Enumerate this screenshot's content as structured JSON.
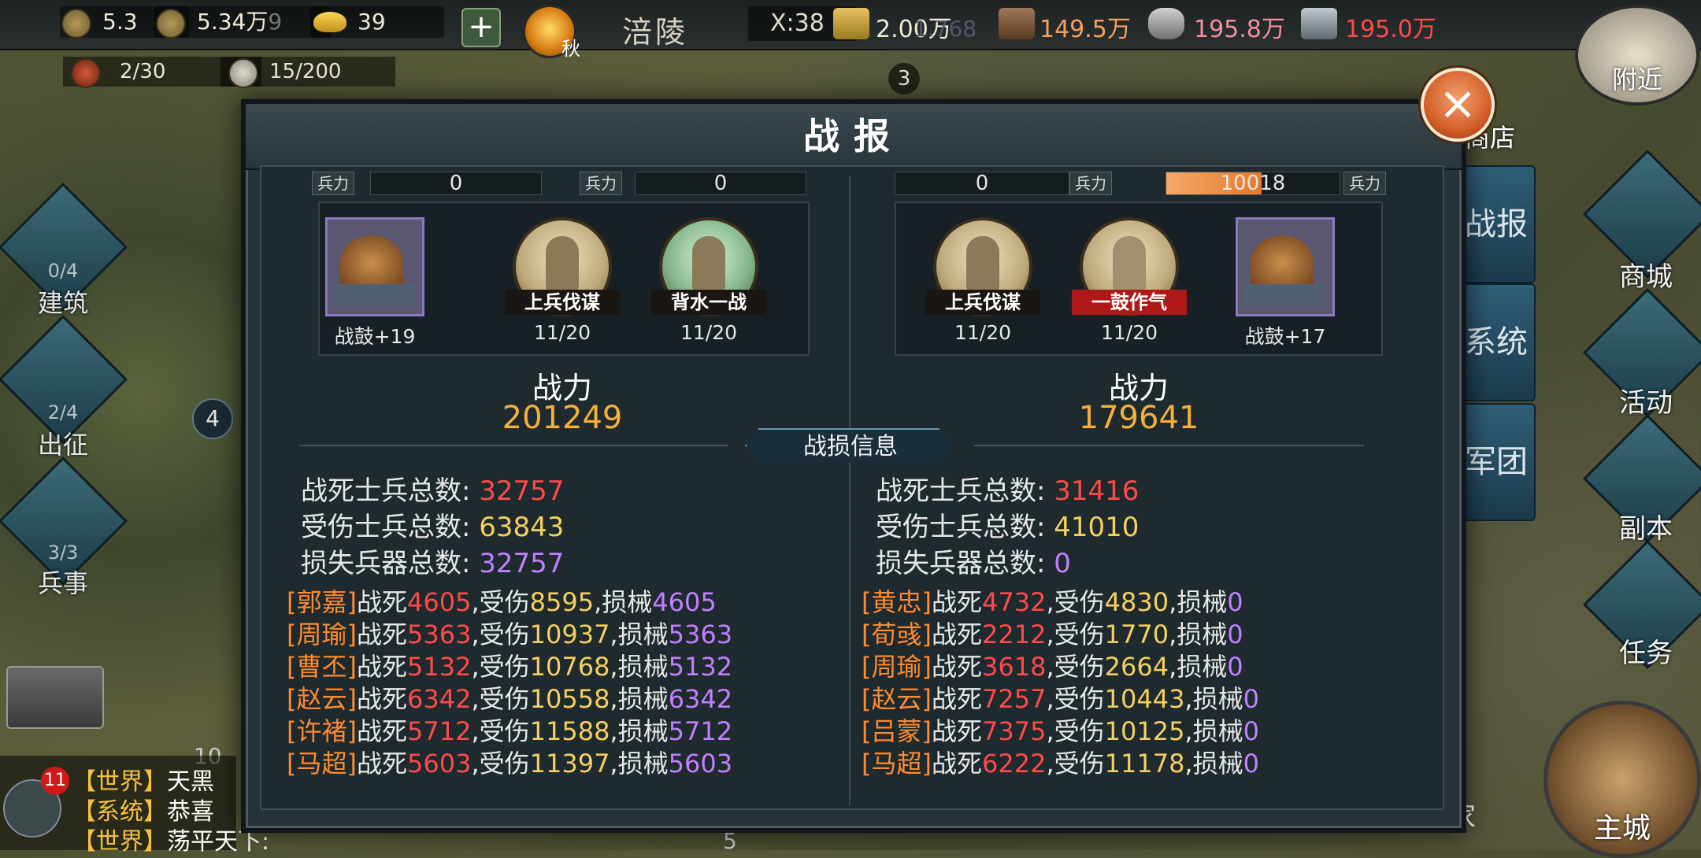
{
  "top": {
    "res1": "5.3",
    "res2": "5.34万",
    "res2_ghost": "9",
    "gold": "39",
    "season": "秋",
    "city": "涪陵",
    "coord": "X:38",
    "food": "2.00万",
    "food_ghost": "1.768",
    "wood": "149.5万",
    "stone": "195.8万",
    "iron": "195.0万"
  },
  "left": {
    "stat_a": "2/30",
    "stat_b": "15/200",
    "jianzhu": {
      "label": "建筑",
      "sub": "0/4"
    },
    "chuzheng": {
      "label": "出征",
      "sub": "2/4"
    },
    "bingshi": {
      "label": "兵事",
      "sub": "3/3"
    },
    "marker": "4",
    "marker2": "10",
    "marker3": "3",
    "marker4": "5"
  },
  "right": {
    "nearby": "附近",
    "shop": "商店",
    "shangcheng": "商城",
    "huodong": "活动",
    "fuben": "副本",
    "renwu": "任务",
    "zhucheng": "主城",
    "home": "家",
    "tab_zhanbao": "战报",
    "tab_xitong": "系统",
    "tab_juntuan": "军团"
  },
  "dialog": {
    "title": "战报",
    "close": "×",
    "troop_label": "兵力",
    "left": {
      "troop1": "0",
      "troop2": "0",
      "items": [
        {
          "label": "战鼓+19"
        },
        {
          "name": "上兵伐谋",
          "count": "11/20"
        },
        {
          "name": "背水一战",
          "count": "11/20"
        }
      ],
      "power_label": "战力",
      "power": "201249",
      "killed_label": "战死士兵总数:",
      "killed": "32757",
      "wounded_label": "受伤士兵总数:",
      "wounded": "63843",
      "lost_label": "损失兵器总数:",
      "lost": "32757",
      "generals": [
        {
          "name": "[郭嘉]",
          "d": "4605",
          "w": "8595",
          "l": "4605"
        },
        {
          "name": "[周瑜]",
          "d": "5363",
          "w": "10937",
          "l": "5363"
        },
        {
          "name": "[曹丕]",
          "d": "5132",
          "w": "10768",
          "l": "5132"
        },
        {
          "name": "[赵云]",
          "d": "6342",
          "w": "10558",
          "l": "6342"
        },
        {
          "name": "[许褚]",
          "d": "5712",
          "w": "11588",
          "l": "5712"
        },
        {
          "name": "[马超]",
          "d": "5603",
          "w": "11397",
          "l": "5603"
        }
      ]
    },
    "right": {
      "troop1": "0",
      "troop2": "10018",
      "troop2_fill": 0.55,
      "items": [
        {
          "name": "上兵伐谋",
          "count": "11/20"
        },
        {
          "name": "一鼓作气",
          "count": "11/20"
        },
        {
          "label": "战鼓+17"
        }
      ],
      "power_label": "战力",
      "power": "179641",
      "killed_label": "战死士兵总数:",
      "killed": "31416",
      "wounded_label": "受伤士兵总数:",
      "wounded": "41010",
      "lost_label": "损失兵器总数:",
      "lost": "0",
      "generals": [
        {
          "name": "[黄忠]",
          "d": "4732",
          "w": "4830",
          "l": "0"
        },
        {
          "name": "[荀彧]",
          "d": "2212",
          "w": "1770",
          "l": "0"
        },
        {
          "name": "[周瑜]",
          "d": "3618",
          "w": "2664",
          "l": "0"
        },
        {
          "name": "[赵云]",
          "d": "7257",
          "w": "10443",
          "l": "0"
        },
        {
          "name": "[吕蒙]",
          "d": "7375",
          "w": "10125",
          "l": "0"
        },
        {
          "name": "[马超]",
          "d": "6222",
          "w": "11178",
          "l": "0"
        }
      ]
    },
    "section": "战损信息",
    "word_dead": "战死",
    "word_wound": "受伤",
    "word_lost": "损械",
    "comma": ","
  },
  "chat": {
    "badge": "11",
    "lines": [
      {
        "tag": "【世界】",
        "text": "天黑"
      },
      {
        "tag": "【系统】",
        "text": "恭喜"
      },
      {
        "tag": "【世界】",
        "text": "荡平天下:"
      }
    ]
  },
  "colors": {
    "accent": "#f5b03a",
    "killed": "#ff4a4a",
    "wounded": "#f5d060",
    "lost": "#c080ff",
    "close": "#d5602a"
  }
}
